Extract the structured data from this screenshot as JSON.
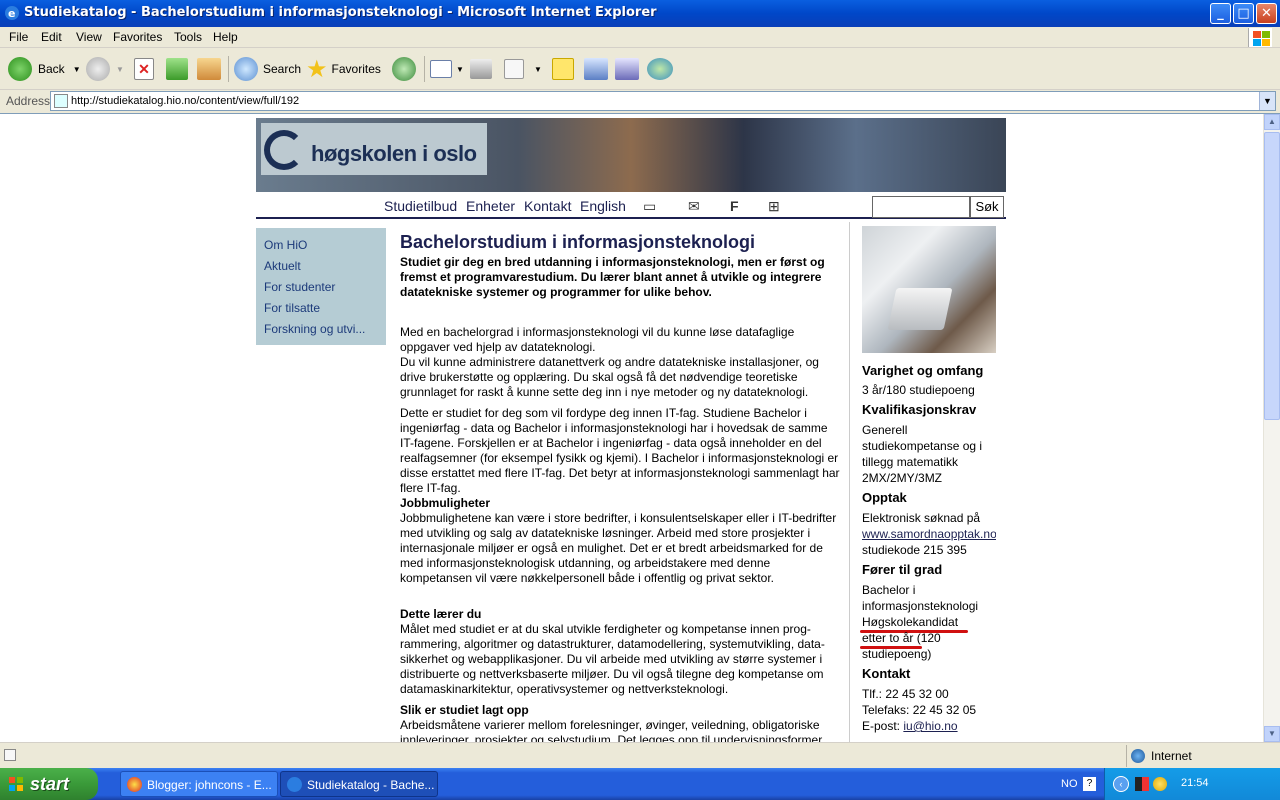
{
  "window": {
    "title": "Studiekatalog - Bachelorstudium i informasjonsteknologi - Microsoft Internet Explorer",
    "buttons": {
      "minimize": "_",
      "maximize": "□",
      "close": "✕"
    }
  },
  "menu": [
    "File",
    "Edit",
    "View",
    "Favorites",
    "Tools",
    "Help"
  ],
  "toolbar": {
    "back": "Back",
    "search": "Search",
    "favorites": "Favorites"
  },
  "address": {
    "label": "Address",
    "url": "http://studiekatalog.hio.no/content/view/full/192"
  },
  "site": {
    "logo": "høgskolen i oslo",
    "nav": [
      "Studietilbud",
      "Enheter",
      "Kontakt",
      "English"
    ],
    "nav_icons": [
      "computer-icon",
      "mail-icon",
      "facebook-icon",
      "book-icon"
    ],
    "search_button": "Søk",
    "search_value": "",
    "leftnav": [
      "Om HiO",
      "Aktuelt",
      "For studenter",
      "For tilsatte",
      "Forskning og utvi..."
    ]
  },
  "content": {
    "heading": "Bachelorstudium i informasjonsteknologi",
    "intro": "Studiet gir deg en bred utdanning i informasjonsteknologi, men er først og fremst et programvarestudium. Du lærer blant annet å utvikle og integrere datatekniske systemer og programmer for ulike behov.",
    "p1": "Med en bachelorgrad i informasjonsteknologi vil du kunne løse datafaglige oppgaver ved hjelp av datateknologi.",
    "p2": "Du vil kunne administrere datanettverk og andre datatekniske installasjoner, og drive brukerstøtte og opplæring. Du skal også få det nødvendige teoretiske grunnlaget for raskt å kunne sette deg inn i nye metoder og ny datateknologi.",
    "p3": "Dette er studiet for deg som vil fordype deg innen IT-fag. Studiene Bachelor i ingeniørfag - data og Bachelor i informasjonsteknologi har i hovedsak de samme IT-fagene. Forskjellen er at Bachelor i ingeniørfag - data også inneholder en del realfagsemner (for eksempel fysikk og kjemi). I Bachelor i informasjonsteknologi er disse erstattet med flere IT-fag. Det betyr at informasjonsteknologi sammenlagt har flere IT-fag.",
    "s1_title": "Jobbmuligheter",
    "s1_text": "Jobbmulighetene kan være i store bedrifter, i konsulentselskaper eller i IT-bedrifter med utvikling og salg av datatekniske løsninger. Arbeid med store prosjekter i internasjonale miljøer er også en mulighet. Det er et bredt arbeidsmarked for de med informasjonsteknologisk utdanning, og arbeidstakere med denne kompetansen vil være nøkkelpersonell både i offentlig og privat sektor.",
    "s2_title": "Dette lærer du",
    "s2_text": "Målet med studiet er at du skal utvikle ferdigheter og kompetanse innen prog-rammering, algoritmer og datastrukturer, datamodellering, systemutvikling, data-sikkerhet og webapplikasjoner. Du vil arbeide med utvikling av større systemer i distribuerte og nettverksbaserte miljøer. Du vil også tilegne deg kompetanse om datamaskinarkitektur, operativsystemer og nettverksteknologi.",
    "s3_title": "Slik er studiet lagt opp",
    "s3_text": "Arbeidsmåtene varierer mellom forelesninger, øvinger, veiledning, obligatoriske innleveringer, prosjekter og selvstudium. Det legges opp til undervisningsformer"
  },
  "sidebar": {
    "h1": "Varighet og omfang",
    "t1": "3 år/180 studiepoeng",
    "h2": "Kvalifikasjonskrav",
    "t2": [
      "Generell",
      "studiekompetanse og i",
      "tillegg matematikk",
      "2MX/2MY/3MZ"
    ],
    "h3": "Opptak",
    "t3a": "Elektronisk søknad på",
    "t3link": "www.samordnaopptak.no",
    "t3b": "studiekode 215 395",
    "h4": "Fører til grad",
    "t4": [
      "Bachelor i",
      "informasjonsteknologi",
      "Høgskolekandidat",
      "etter to år",
      "(120",
      "studiepoeng)"
    ],
    "h5": "Kontakt",
    "tlf": "Tlf.: 22 45 32 00",
    "fax": "Telefaks: 22 45 32 05",
    "email_label": "E-post:",
    "email": "iu@hio.no"
  },
  "statusbar": {
    "zone": "Internet"
  },
  "taskbar": {
    "start": "start",
    "tasks": [
      "Blogger: johncons - E...",
      "Studiekatalog - Bache..."
    ],
    "lang": "NO",
    "clock": "21:54"
  },
  "colors": {
    "accent": "#1c2050",
    "underline_mark": "#d01010"
  }
}
